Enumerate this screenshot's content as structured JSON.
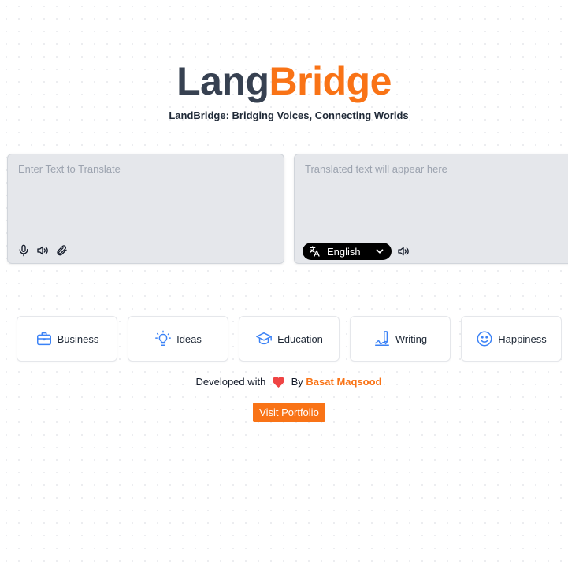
{
  "header": {
    "title_part1": "Lang",
    "title_part2": "Bridge",
    "subtitle": "LandBridge: Bridging Voices, Connecting Worlds"
  },
  "input_panel": {
    "placeholder": "Enter Text to Translate",
    "icons": [
      "microphone-icon",
      "speaker-icon",
      "paperclip-icon"
    ]
  },
  "output_panel": {
    "placeholder": "Translated text will appear here",
    "language": "English",
    "icons": [
      "translate-icon",
      "chevron-down-icon",
      "speaker-icon"
    ]
  },
  "categories": [
    {
      "label": "Business",
      "icon": "briefcase-icon"
    },
    {
      "label": "Ideas",
      "icon": "lightbulb-icon"
    },
    {
      "label": "Education",
      "icon": "graduation-cap-icon"
    },
    {
      "label": "Writing",
      "icon": "pen-icon"
    },
    {
      "label": "Happiness",
      "icon": "smiley-icon"
    }
  ],
  "footer": {
    "developed_with": "Developed with",
    "by": "By",
    "author": "Basat Maqsood",
    "portfolio_button": "Visit Portfolio"
  },
  "colors": {
    "accent": "#f97316",
    "title_dark": "#374151",
    "icon_blue": "#3b82f6",
    "heart": "#ef4444",
    "panel_bg": "#e5e7eb"
  }
}
